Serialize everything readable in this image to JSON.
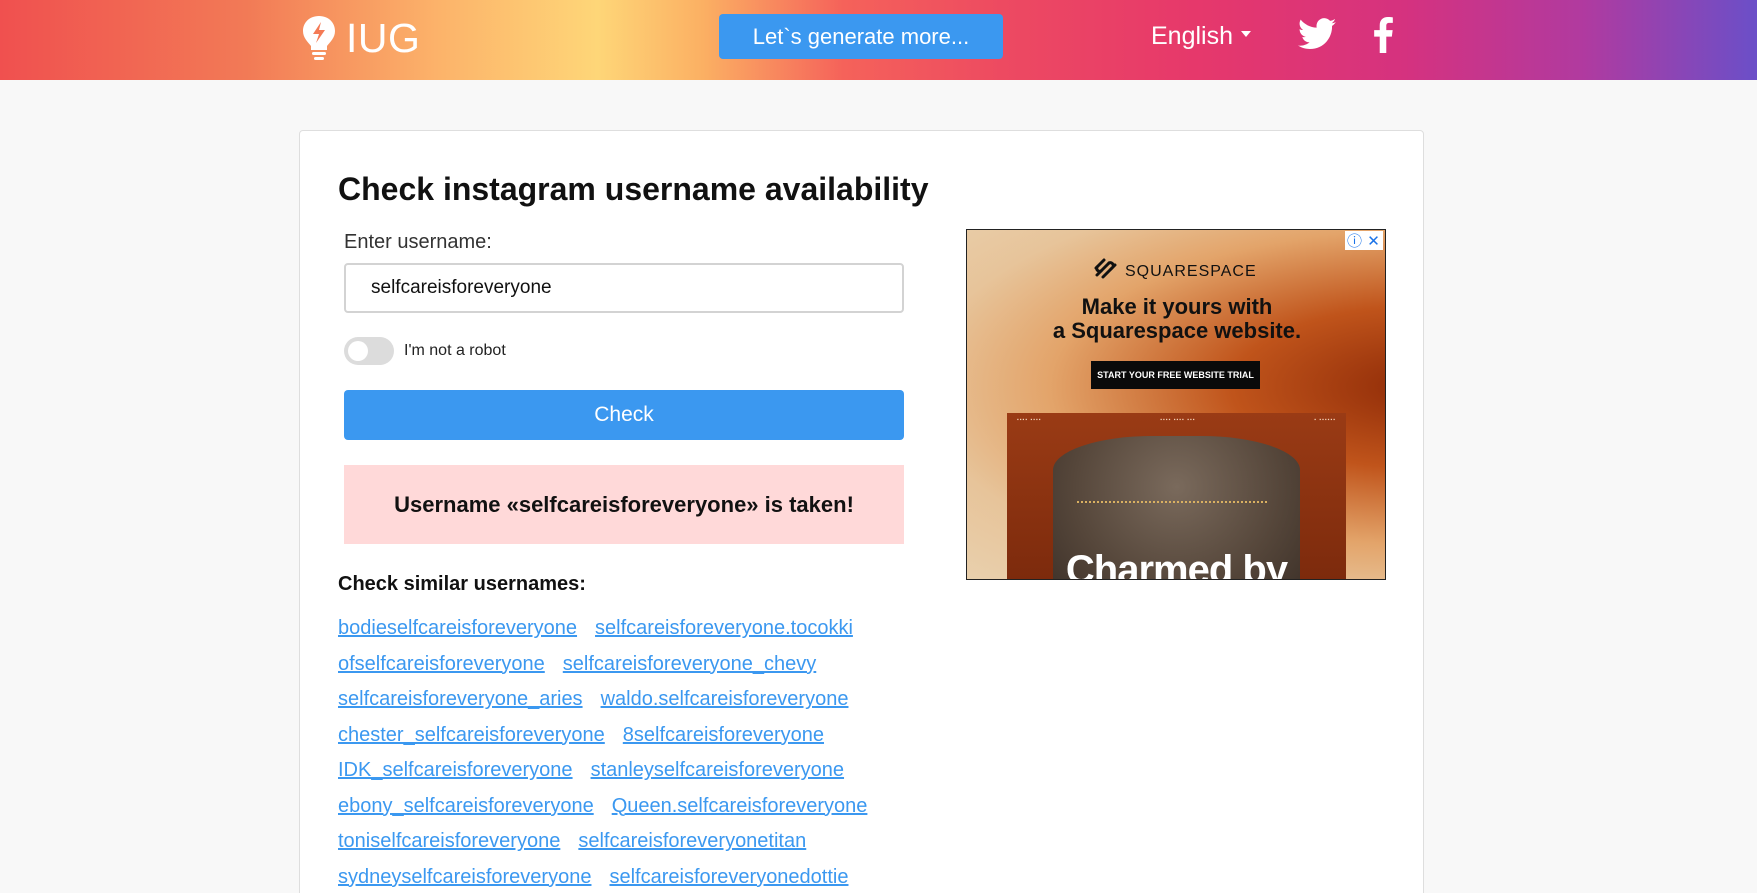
{
  "header": {
    "logo_text": "IUG",
    "generate_button": "Let`s generate more...",
    "language": "English"
  },
  "main": {
    "title": "Check instagram username availability",
    "input_label": "Enter username:",
    "username_value": "selfcareisforeveryone",
    "robot_label": "I'm not a robot",
    "check_button": "Check",
    "result_message": "Username «selfcareisforeveryone» is taken!",
    "similar_title": "Check similar usernames:",
    "similar_rows": [
      [
        "bodieselfcareisforeveryone",
        "selfcareisforeveryone.tocokki"
      ],
      [
        "ofselfcareisforeveryone",
        "selfcareisforeveryone_chevy"
      ],
      [
        "selfcareisforeveryone_aries",
        "waldo.selfcareisforeveryone"
      ],
      [
        "chester_selfcareisforeveryone",
        "8selfcareisforeveryone"
      ],
      [
        "IDK_selfcareisforeveryone",
        "stanleyselfcareisforeveryone"
      ],
      [
        "ebony_selfcareisforeveryone",
        "Queen.selfcareisforeveryone"
      ],
      [
        "toniselfcareisforeveryone",
        "selfcareisforeveryonetitan"
      ],
      [
        "sydneyselfcareisforeveryone",
        "selfcareisforeveryonedottie"
      ]
    ]
  },
  "ad": {
    "brand": "SQUARESPACE",
    "headline_line1": "Make it yours with",
    "headline_line2": "a Squarespace website.",
    "cta": "START YOUR FREE WEBSITE TRIAL",
    "photo_caption": "Charmed by"
  },
  "colors": {
    "accent_blue": "#3b98f0",
    "error_bg": "#ffd9d9"
  },
  "icons": [
    "lightbulb-icon",
    "caret-down-icon",
    "twitter-icon",
    "facebook-icon",
    "ad-info-icon",
    "ad-close-icon",
    "squarespace-logo-icon"
  ]
}
